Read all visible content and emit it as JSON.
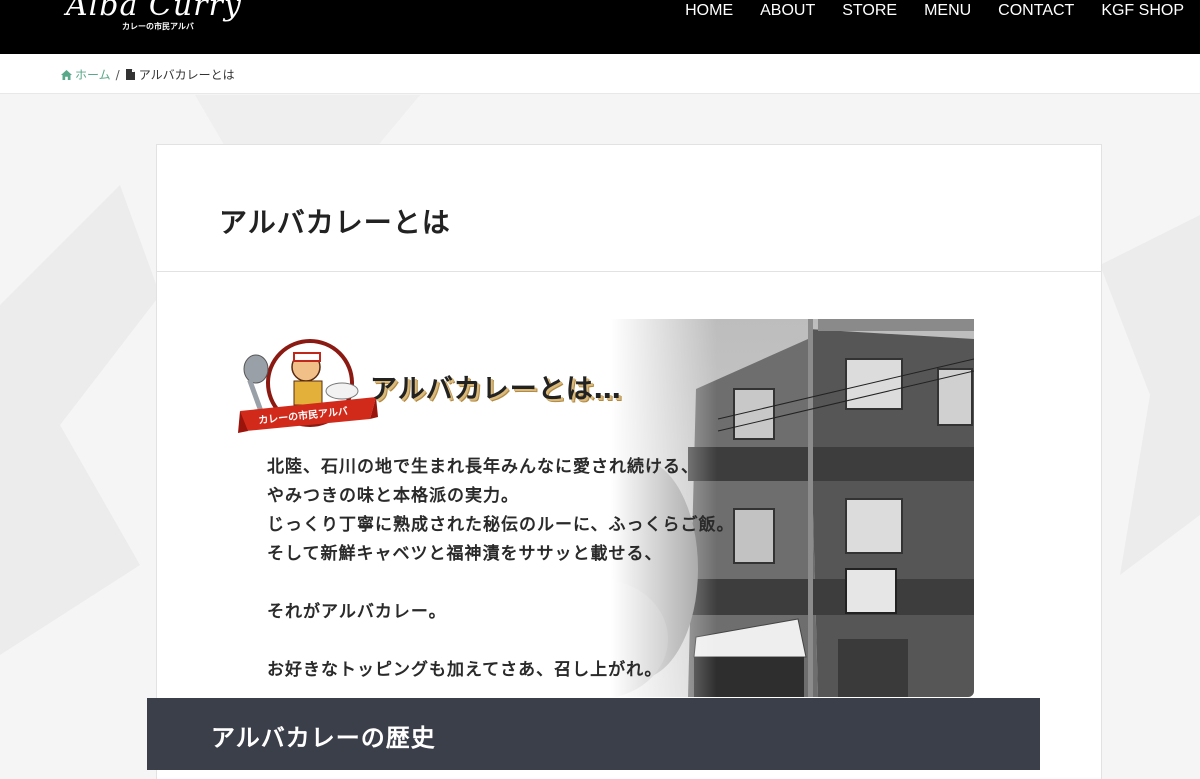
{
  "header": {
    "logo_text": "Alba Curry",
    "logo_subtext": "カレーの市民アルバ",
    "nav": [
      {
        "label": "HOME"
      },
      {
        "label": "ABOUT"
      },
      {
        "label": "STORE"
      },
      {
        "label": "MENU"
      },
      {
        "label": "CONTACT"
      },
      {
        "label": "KGF SHOP"
      }
    ]
  },
  "breadcrumb": {
    "home_label": "ホーム",
    "separator": "/",
    "current_label": "アルバカレーとは"
  },
  "page": {
    "title": "アルバカレーとは"
  },
  "hero": {
    "heading": "アルバカレーとは…",
    "mascot_badge": "カレーの市民アルバ",
    "lines": [
      "北陸、石川の地で生まれ長年みんなに愛され続ける、",
      "やみつきの味と本格派の実力。",
      "じっくり丁寧に熟成された秘伝のルーに、ふっくらご飯。",
      "そして新鮮キャベツと福神漬をササッと載せる、",
      "それがアルバカレー。",
      "お好きなトッピングも加えてさあ、召し上がれ。"
    ]
  },
  "section": {
    "title": "アルバカレーの歴史"
  },
  "colors": {
    "header_bg": "#000000",
    "breadcrumb_home": "#5aa88a",
    "section_bar_bg": "#3b3f49"
  }
}
